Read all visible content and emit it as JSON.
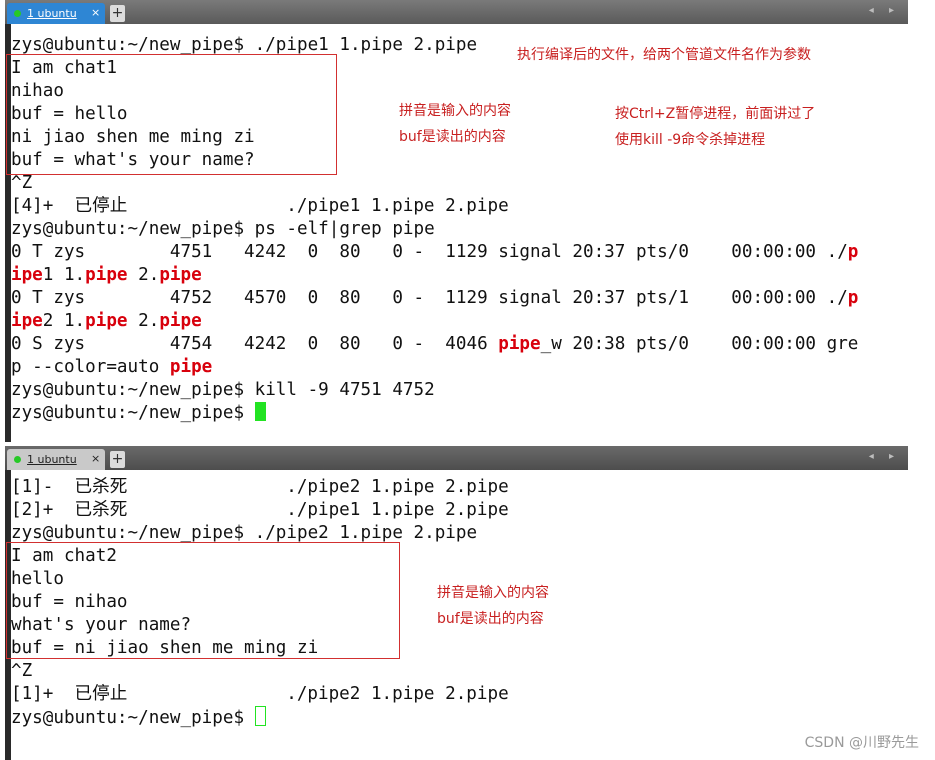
{
  "colors": {
    "accent": "#2e86d4",
    "highlight": "#d8000c",
    "cursor": "#22e322",
    "annotation": "#c82020"
  },
  "top_pane": {
    "tab_label": "1 ubuntu",
    "tab_close": "×",
    "new_tab": "+",
    "nav": "◂ ▸",
    "lines": [
      "zys@ubuntu:~/new_pipe$ ./pipe1 1.pipe 2.pipe",
      "I am chat1",
      "nihao",
      "buf = hello",
      "ni jiao shen me ming zi",
      "buf = what's your name?",
      "^Z",
      "[4]+  已停止               ./pipe1 1.pipe 2.pipe",
      "zys@ubuntu:~/new_pipe$ ps -elf|grep pipe"
    ],
    "ps_row1": {
      "a": "0 T zys        4751   4242  0  80   0 -  1129 signal 20:37 pts/0    00:00:00 ./",
      "b": "p",
      "c": "ipe",
      "d": "1 1.",
      "e": "pipe",
      "f": " 2.",
      "g": "pipe"
    },
    "ps_row2": {
      "a": "0 T zys        4752   4570  0  80   0 -  1129 signal 20:37 pts/1    00:00:00 ./",
      "b": "p",
      "c": "ipe",
      "d": "2 1.",
      "e": "pipe",
      "f": " 2.",
      "g": "pipe"
    },
    "ps_row3": {
      "a": "0 S zys        4754   4242  0  80   0 -  4046 ",
      "b": "pipe",
      "c": "_w 20:38 pts/0    00:00:00 gre",
      "d": "p --color=auto ",
      "e": "pipe"
    },
    "kill_line": "zys@ubuntu:~/new_pipe$ kill -9 4751 4752",
    "prompt": "zys@ubuntu:~/new_pipe$ ",
    "annotations": {
      "note1": "执行编译后的文件，给两个管道文件名作为参数",
      "note2": "拼音是输入的内容",
      "note3": "buf是读出的内容",
      "note4": "按Ctrl+Z暂停进程，前面讲过了",
      "note5": "使用kill -9命令杀掉进程"
    }
  },
  "bottom_pane": {
    "tab_label": "1 ubuntu",
    "tab_close": "×",
    "new_tab": "+",
    "nav": "◂ ▸",
    "lines": [
      "[1]-  已杀死               ./pipe2 1.pipe 2.pipe",
      "[2]+  已杀死               ./pipe1 1.pipe 2.pipe",
      "zys@ubuntu:~/new_pipe$ ./pipe2 1.pipe 2.pipe",
      "I am chat2",
      "hello",
      "buf = nihao",
      "what's your name?",
      "buf = ni jiao shen me ming zi",
      "^Z",
      "[1]+  已停止               ./pipe2 1.pipe 2.pipe"
    ],
    "prompt": "zys@ubuntu:~/new_pipe$ ",
    "annotations": {
      "note1": "拼音是输入的内容",
      "note2": "buf是读出的内容"
    }
  },
  "watermark": "CSDN @川野先生"
}
